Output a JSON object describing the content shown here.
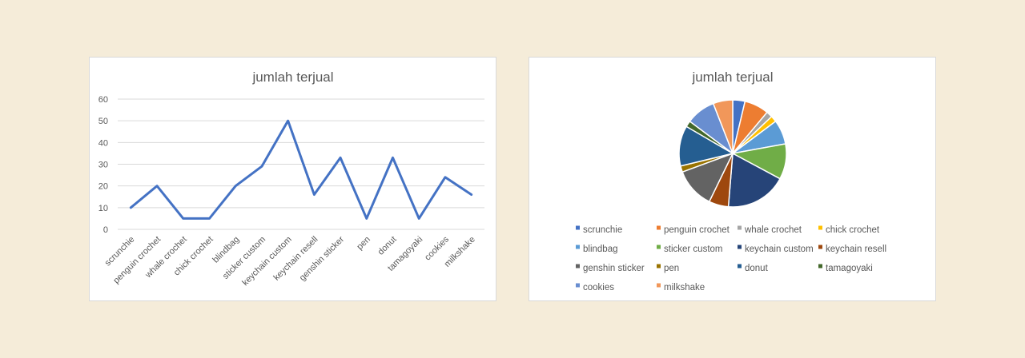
{
  "chart_data": [
    {
      "type": "line",
      "title": "jumlah terjual",
      "categories": [
        "scrunchie",
        "penguin crochet",
        "whale crochet",
        "chick crochet",
        "blindbag",
        "sticker custom",
        "keychain custom",
        "keychain resell",
        "genshin sticker",
        "pen",
        "donut",
        "tamagoyaki",
        "cookies",
        "milkshake"
      ],
      "series": [
        {
          "values": [
            10,
            20,
            5,
            5,
            20,
            29,
            50,
            16,
            33,
            5,
            33,
            5,
            24,
            16
          ],
          "color": "#4472c4"
        }
      ],
      "ylim": [
        0,
        60
      ],
      "yticks": [
        0,
        10,
        20,
        30,
        40,
        50,
        60
      ],
      "grid": true
    },
    {
      "type": "pie",
      "title": "jumlah terjual",
      "categories": [
        "scrunchie",
        "penguin crochet",
        "whale crochet",
        "chick crochet",
        "blindbag",
        "sticker custom",
        "keychain custom",
        "keychain resell",
        "genshin sticker",
        "pen",
        "donut",
        "tamagoyaki",
        "cookies",
        "milkshake"
      ],
      "values": [
        10,
        20,
        5,
        5,
        20,
        29,
        50,
        16,
        33,
        5,
        33,
        5,
        24,
        16
      ],
      "colors": [
        "#4472c4",
        "#ed7d31",
        "#a5a5a5",
        "#ffc000",
        "#5b9bd5",
        "#70ad47",
        "#264478",
        "#9e480e",
        "#636363",
        "#997300",
        "#255e91",
        "#43682b",
        "#698ed0",
        "#f1975a"
      ],
      "legend": "bottom"
    }
  ]
}
